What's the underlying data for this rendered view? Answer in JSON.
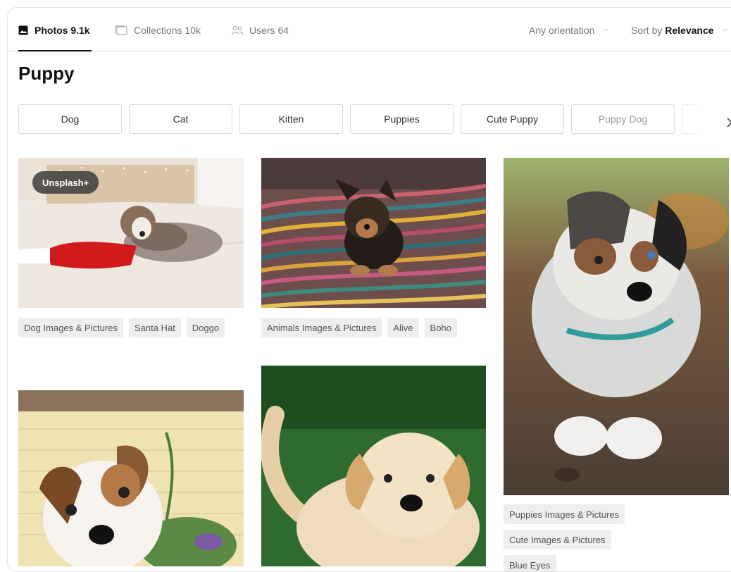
{
  "tabs": [
    {
      "label": "Photos 9.1k",
      "icon": "image-icon"
    },
    {
      "label": "Collections 10k",
      "icon": "collections-icon"
    },
    {
      "label": "Users 64",
      "icon": "users-icon"
    }
  ],
  "filters": {
    "orientation": "Any orientation",
    "sort_prefix": "Sort by",
    "sort_value": "Relevance"
  },
  "page_title": "Puppy",
  "related_searches": [
    "Dog",
    "Cat",
    "Kitten",
    "Puppies",
    "Cute Puppy",
    "Puppy Dog"
  ],
  "photos": {
    "p1": {
      "badge": "Unsplash+",
      "tags": [
        "Dog Images & Pictures",
        "Santa Hat",
        "Doggo"
      ]
    },
    "p2": {
      "tags": [
        "Animals Images & Pictures",
        "Alive",
        "Boho"
      ]
    },
    "p3": {
      "tags": [
        "Puppies Images & Pictures",
        "Cute Images & Pictures",
        "Blue Eyes"
      ]
    }
  },
  "colors": {
    "accent": "#111111",
    "tag_bg": "#eeeeee",
    "border": "#d9d9d9"
  }
}
